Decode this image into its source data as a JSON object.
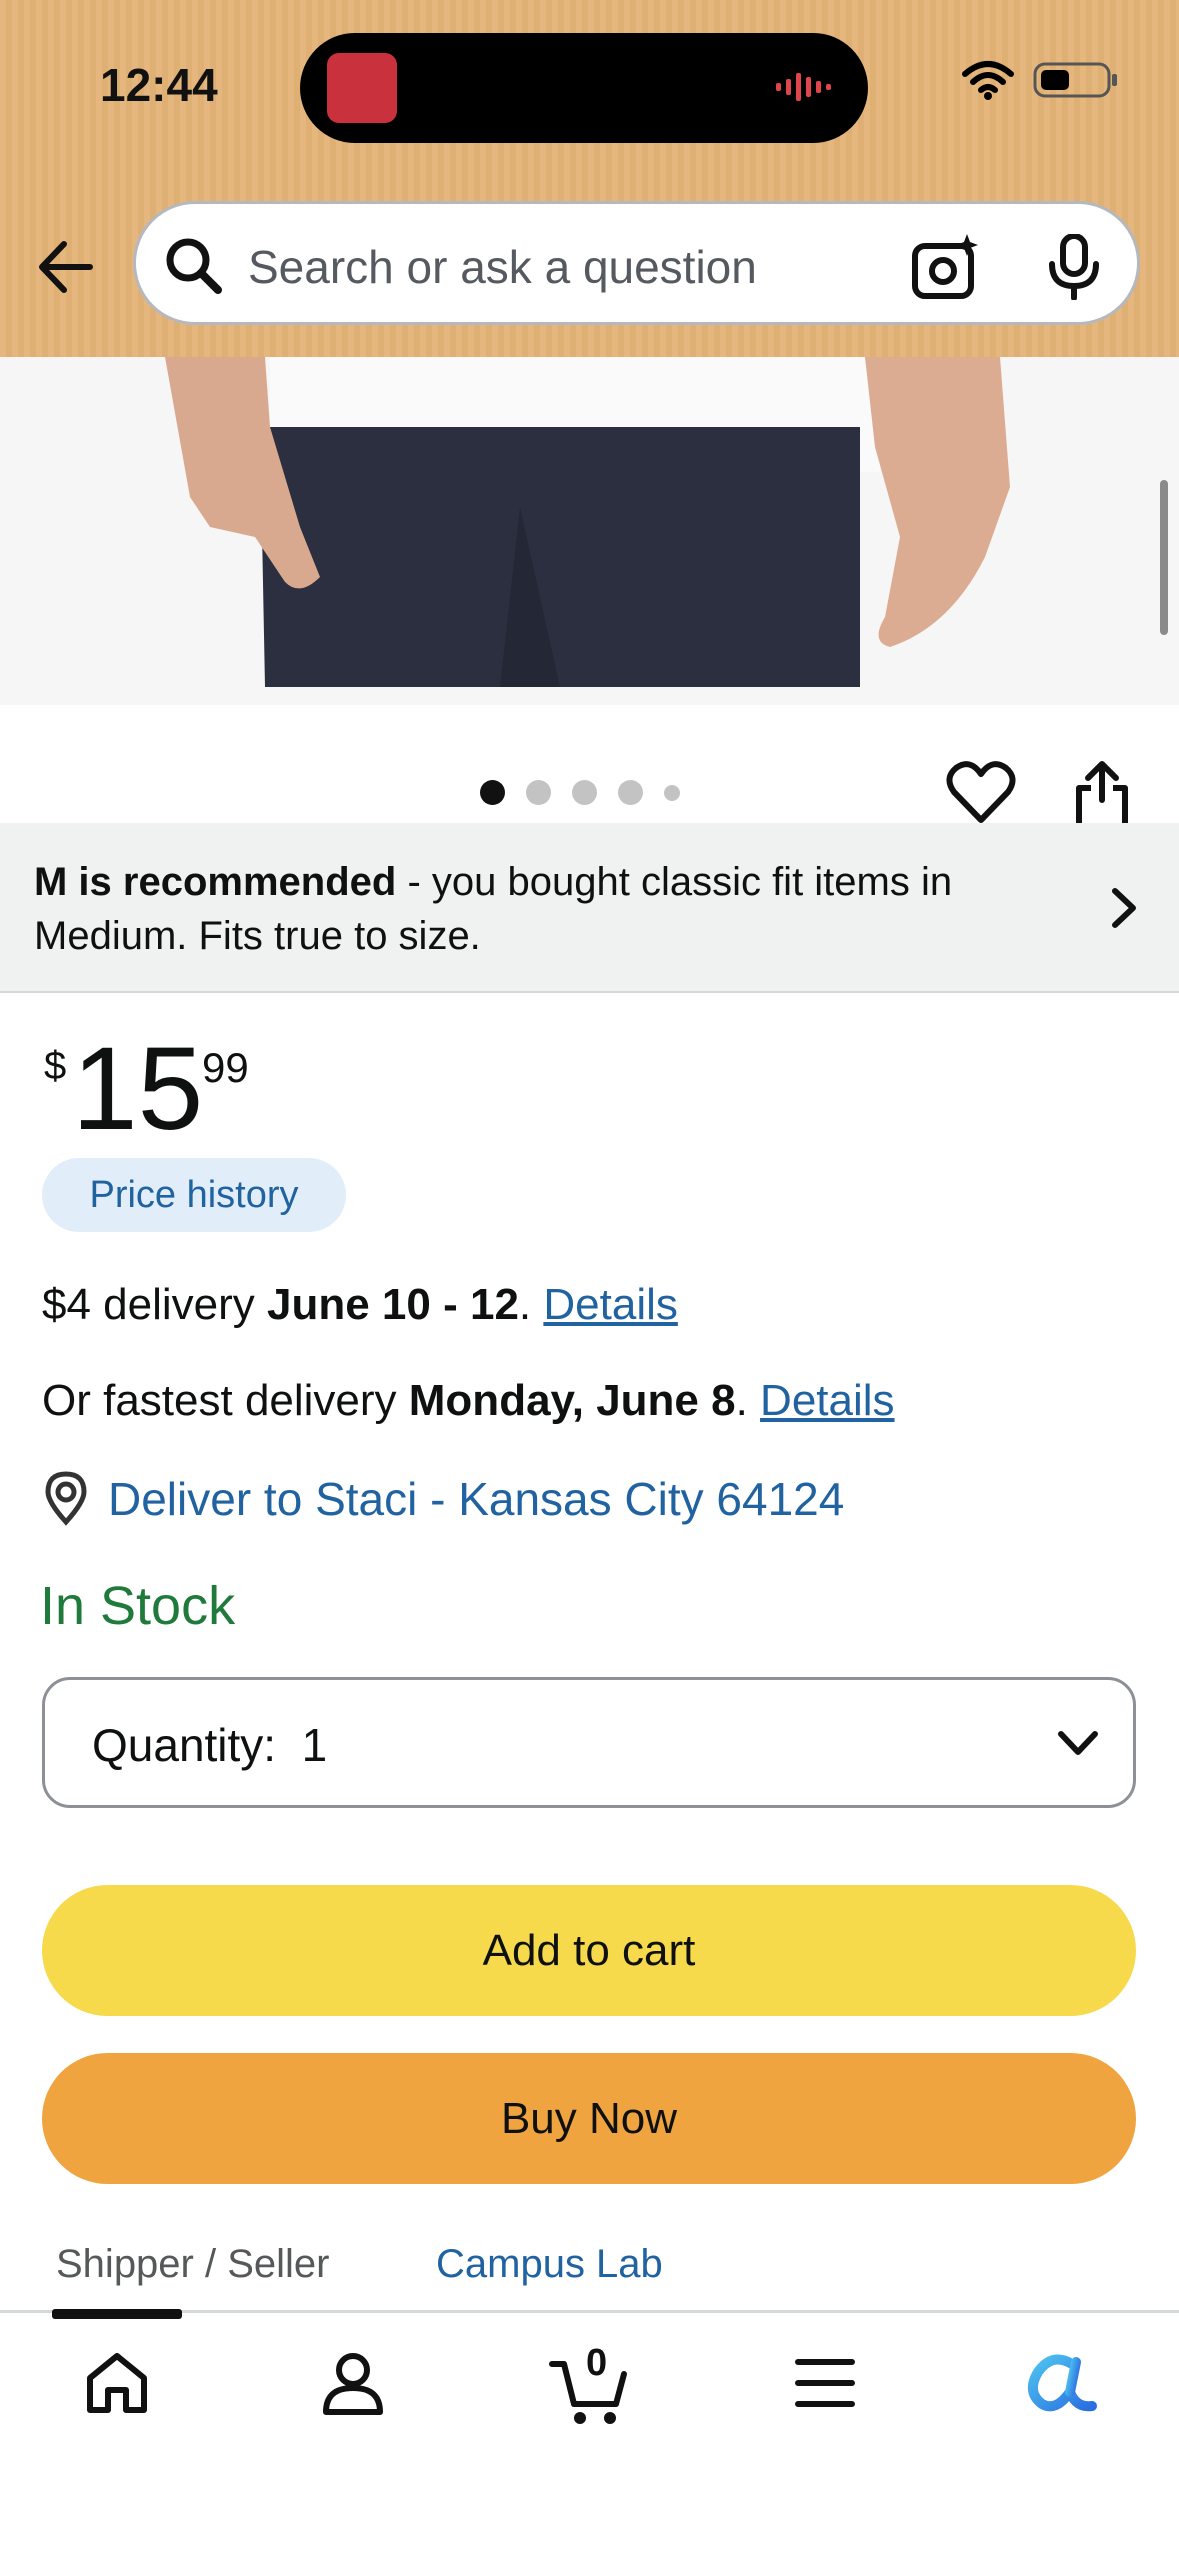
{
  "status_bar": {
    "time": "12:44"
  },
  "search": {
    "placeholder": "Search or ask a question"
  },
  "product": {
    "image_dots_active": 1,
    "fit_banner": {
      "bold": "M is recommended",
      "text": " - you bought classic fit items in Medium. Fits true to size."
    },
    "price": {
      "symbol": "$",
      "whole": "15",
      "fraction": "99"
    },
    "price_history_label": "Price history",
    "delivery": {
      "prefix": "$4 delivery ",
      "date": "June 10 - 12",
      "suffix": ". ",
      "link": "Details"
    },
    "fastest": {
      "prefix": "Or fastest delivery ",
      "date": "Monday, June 8",
      "suffix": ". ",
      "link": "Details"
    },
    "deliver_to": "Deliver to Staci - Kansas City 64124",
    "stock": "In Stock",
    "quantity_label": "Quantity:",
    "quantity_value": "1",
    "add_to_cart": "Add to cart",
    "buy_now": "Buy Now",
    "seller_label": "Shipper / Seller",
    "seller_value": "Campus Lab"
  },
  "nav": {
    "cart_count": "0"
  },
  "colors": {
    "header": "#e5b77e",
    "add_to_cart": "#f7d94c",
    "buy_now": "#efa43f",
    "link": "#2162a1",
    "in_stock": "#1f7a3c"
  }
}
